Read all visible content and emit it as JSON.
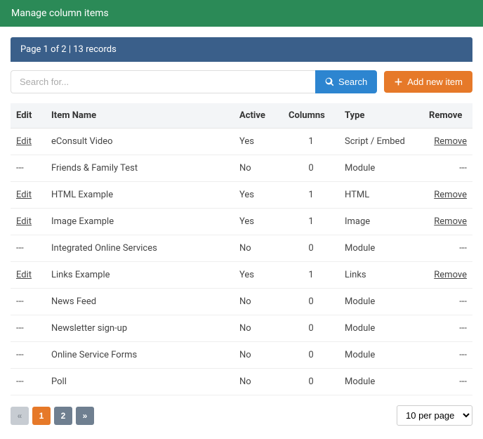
{
  "header": {
    "title": "Manage column items"
  },
  "subheader": {
    "text": "Page 1 of 2 | 13 records"
  },
  "search": {
    "placeholder": "Search for...",
    "value": "",
    "button_label": "Search",
    "add_label": "Add new item"
  },
  "table": {
    "headers": {
      "edit": "Edit",
      "name": "Item Name",
      "active": "Active",
      "columns": "Columns",
      "type": "Type",
      "remove": "Remove"
    },
    "rows": [
      {
        "edit": "Edit",
        "name": "eConsult Video",
        "active": "Yes",
        "columns": "1",
        "type": "Script / Embed",
        "remove": "Remove"
      },
      {
        "edit": "---",
        "name": "Friends & Family Test",
        "active": "No",
        "columns": "0",
        "type": "Module",
        "remove": "---"
      },
      {
        "edit": "Edit",
        "name": "HTML Example",
        "active": "Yes",
        "columns": "1",
        "type": "HTML",
        "remove": "Remove"
      },
      {
        "edit": "Edit",
        "name": "Image Example",
        "active": "Yes",
        "columns": "1",
        "type": "Image",
        "remove": "Remove"
      },
      {
        "edit": "---",
        "name": "Integrated Online Services",
        "active": "No",
        "columns": "0",
        "type": "Module",
        "remove": "---"
      },
      {
        "edit": "Edit",
        "name": "Links Example",
        "active": "Yes",
        "columns": "1",
        "type": "Links",
        "remove": "Remove"
      },
      {
        "edit": "---",
        "name": "News Feed",
        "active": "No",
        "columns": "0",
        "type": "Module",
        "remove": "---"
      },
      {
        "edit": "---",
        "name": "Newsletter sign-up",
        "active": "No",
        "columns": "0",
        "type": "Module",
        "remove": "---"
      },
      {
        "edit": "---",
        "name": "Online Service Forms",
        "active": "No",
        "columns": "0",
        "type": "Module",
        "remove": "---"
      },
      {
        "edit": "---",
        "name": "Poll",
        "active": "No",
        "columns": "0",
        "type": "Module",
        "remove": "---"
      }
    ]
  },
  "pagination": {
    "prev": "«",
    "pages": [
      "1",
      "2"
    ],
    "next": "»",
    "current": "1",
    "per_page_selected": "10 per page"
  }
}
